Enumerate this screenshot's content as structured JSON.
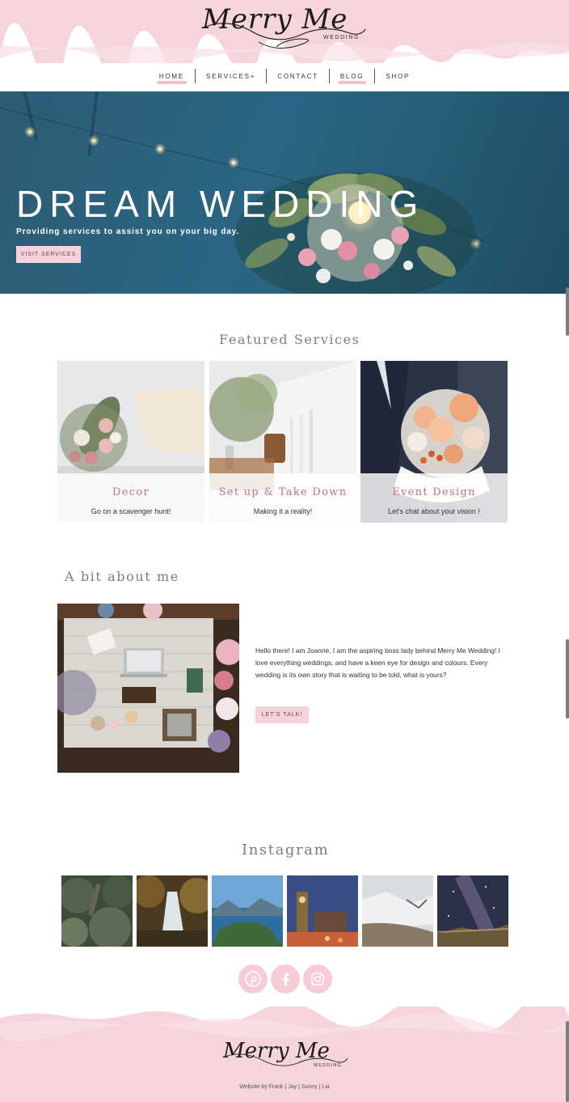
{
  "brand": {
    "logo_text": "Merry Me",
    "logo_sub": "WEDDING"
  },
  "nav": {
    "items": [
      {
        "label": "HOME",
        "active": true
      },
      {
        "label": "SERVICES+",
        "active": false
      },
      {
        "label": "CONTACT",
        "active": false
      },
      {
        "label": "BLOG",
        "active": true
      },
      {
        "label": "SHOP",
        "active": false
      }
    ]
  },
  "hero": {
    "title": "DREAM WEDDING",
    "subtitle": "Providing services to assist you on your big day.",
    "button_label": "VISIT SERVICES"
  },
  "featured": {
    "title": "Featured Services",
    "cards": [
      {
        "title": "Decor",
        "desc": "Go on a scavenger hunt!"
      },
      {
        "title": "Set up & Take Down",
        "desc": "Making it a reality!"
      },
      {
        "title": "Event Design",
        "desc": "Let's chat about your vision !"
      }
    ]
  },
  "about": {
    "title": "A bit about me",
    "text": "Hello there! I am Joanne, I am the aspiring boss lady behind Merry Me Wedding! I love everything weddings, and have a keen eye for design and colours. Every wedding is its own story that is waiting to be told, what is yours?",
    "button_label": "LET'S TALK!"
  },
  "instagram": {
    "title": "Instagram"
  },
  "social": {
    "icons": [
      "pinterest-icon",
      "facebook-icon",
      "instagram-icon"
    ]
  },
  "footer": {
    "logo_text": "Merry Me",
    "logo_sub": "WEDDING",
    "credit": "Website by Frank | Jay | Sunny | Lia"
  },
  "colors": {
    "accent_pink": "#f7d2da",
    "title_rose": "#c2727f",
    "hero_blue": "#2b6684"
  }
}
